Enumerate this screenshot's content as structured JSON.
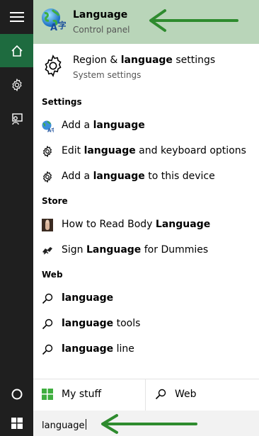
{
  "best_match": {
    "title": "Language",
    "subtitle": "Control panel",
    "icon": "language-globe-icon"
  },
  "top_result": {
    "title_prefix": "Region & ",
    "title_bold": "language",
    "title_suffix": " settings",
    "subtitle": "System settings",
    "icon": "gear-icon"
  },
  "sections": {
    "settings": {
      "header": "Settings",
      "items": [
        {
          "prefix": "Add a ",
          "bold": "language",
          "suffix": "",
          "icon": "language-globe-icon"
        },
        {
          "prefix": "Edit ",
          "bold": "language",
          "suffix": " and keyboard options",
          "icon": "gear-icon"
        },
        {
          "prefix": "Add a ",
          "bold": "language",
          "suffix": " to this device",
          "icon": "gear-icon"
        }
      ]
    },
    "store": {
      "header": "Store",
      "items": [
        {
          "prefix": "How to Read Body ",
          "bold": "Language",
          "suffix": "",
          "icon": "book-cover-icon"
        },
        {
          "prefix": "Sign ",
          "bold": "Language",
          "suffix": " for Dummies",
          "icon": "sign-hands-icon"
        }
      ]
    },
    "web": {
      "header": "Web",
      "items": [
        {
          "prefix": "",
          "bold": "language",
          "suffix": "",
          "icon": "search-icon"
        },
        {
          "prefix": "",
          "bold": "language",
          "suffix": " tools",
          "icon": "search-icon"
        },
        {
          "prefix": "",
          "bold": "language",
          "suffix": " line",
          "icon": "search-icon"
        }
      ]
    }
  },
  "filters": {
    "my_stuff": "My stuff",
    "web": "Web"
  },
  "search": {
    "query": "language"
  },
  "colors": {
    "rail_bg": "#1f1f1f",
    "rail_active": "#1e6b3f",
    "best_match_bg": "#b9d5b9",
    "annotation_arrow": "#2e8b2e"
  }
}
